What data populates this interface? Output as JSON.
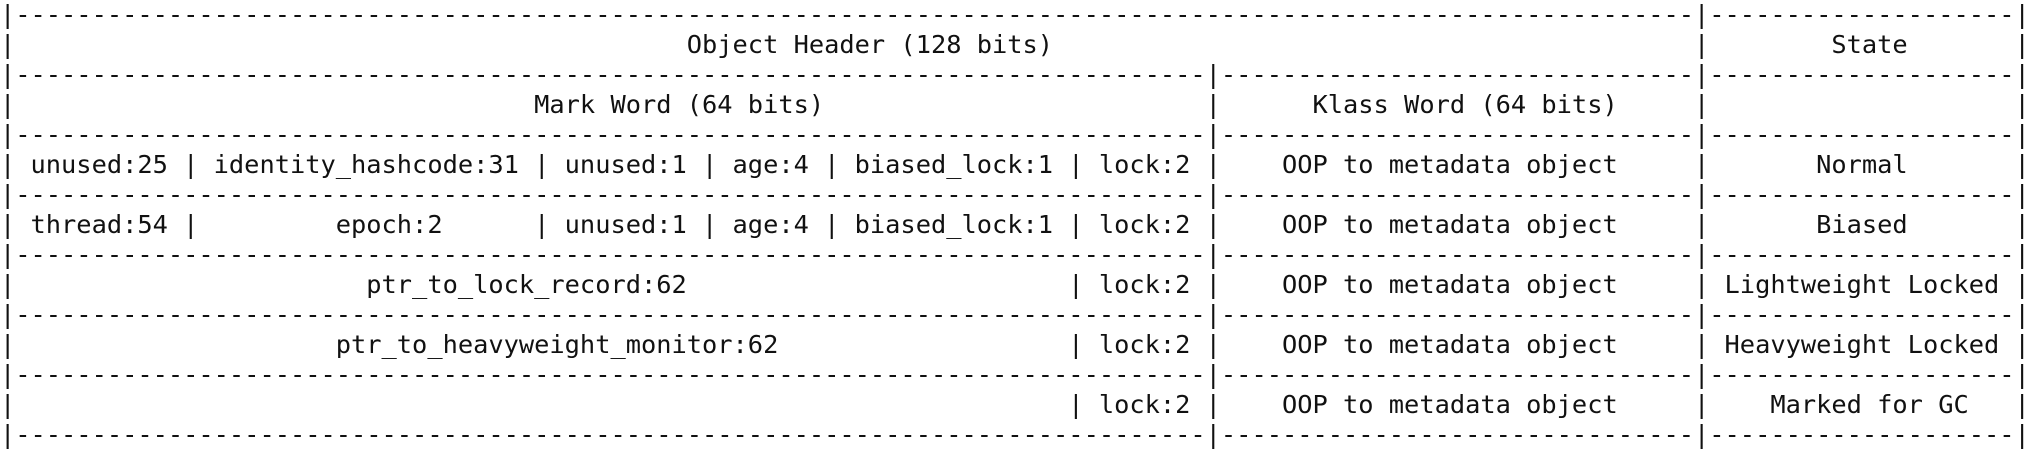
{
  "object_header_title": "Object Header (128 bits)",
  "state_title": "State",
  "mark_word_title": "Mark Word (64 bits)",
  "klass_word_title": "Klass Word (64 bits)",
  "lines": [
    "|--------------------------------------------------------------------------------------------------------------|--------------------|",
    "|                                            Object Header (128 bits)                                          |        State       |",
    "|------------------------------------------------------------------------------|-------------------------------|--------------------|",
    "|                                  Mark Word (64 bits)                         |      Klass Word (64 bits)     |                    |",
    "|------------------------------------------------------------------------------|-------------------------------|--------------------|",
    "| unused:25 | identity_hashcode:31 | unused:1 | age:4 | biased_lock:1 | lock:2 |    OOP to metadata object     |       Normal       |",
    "|------------------------------------------------------------------------------|-------------------------------|--------------------|",
    "| thread:54 |         epoch:2      | unused:1 | age:4 | biased_lock:1 | lock:2 |    OOP to metadata object     |       Biased       |",
    "|------------------------------------------------------------------------------|-------------------------------|--------------------|",
    "|                       ptr_to_lock_record:62                         | lock:2 |    OOP to metadata object     | Lightweight Locked |",
    "|------------------------------------------------------------------------------|-------------------------------|--------------------|",
    "|                     ptr_to_heavyweight_monitor:62                   | lock:2 |    OOP to metadata object     | Heavyweight Locked |",
    "|------------------------------------------------------------------------------|-------------------------------|--------------------|",
    "|                                                                     | lock:2 |    OOP to metadata object     |    Marked for GC   |",
    "|------------------------------------------------------------------------------|-------------------------------|--------------------|"
  ]
}
